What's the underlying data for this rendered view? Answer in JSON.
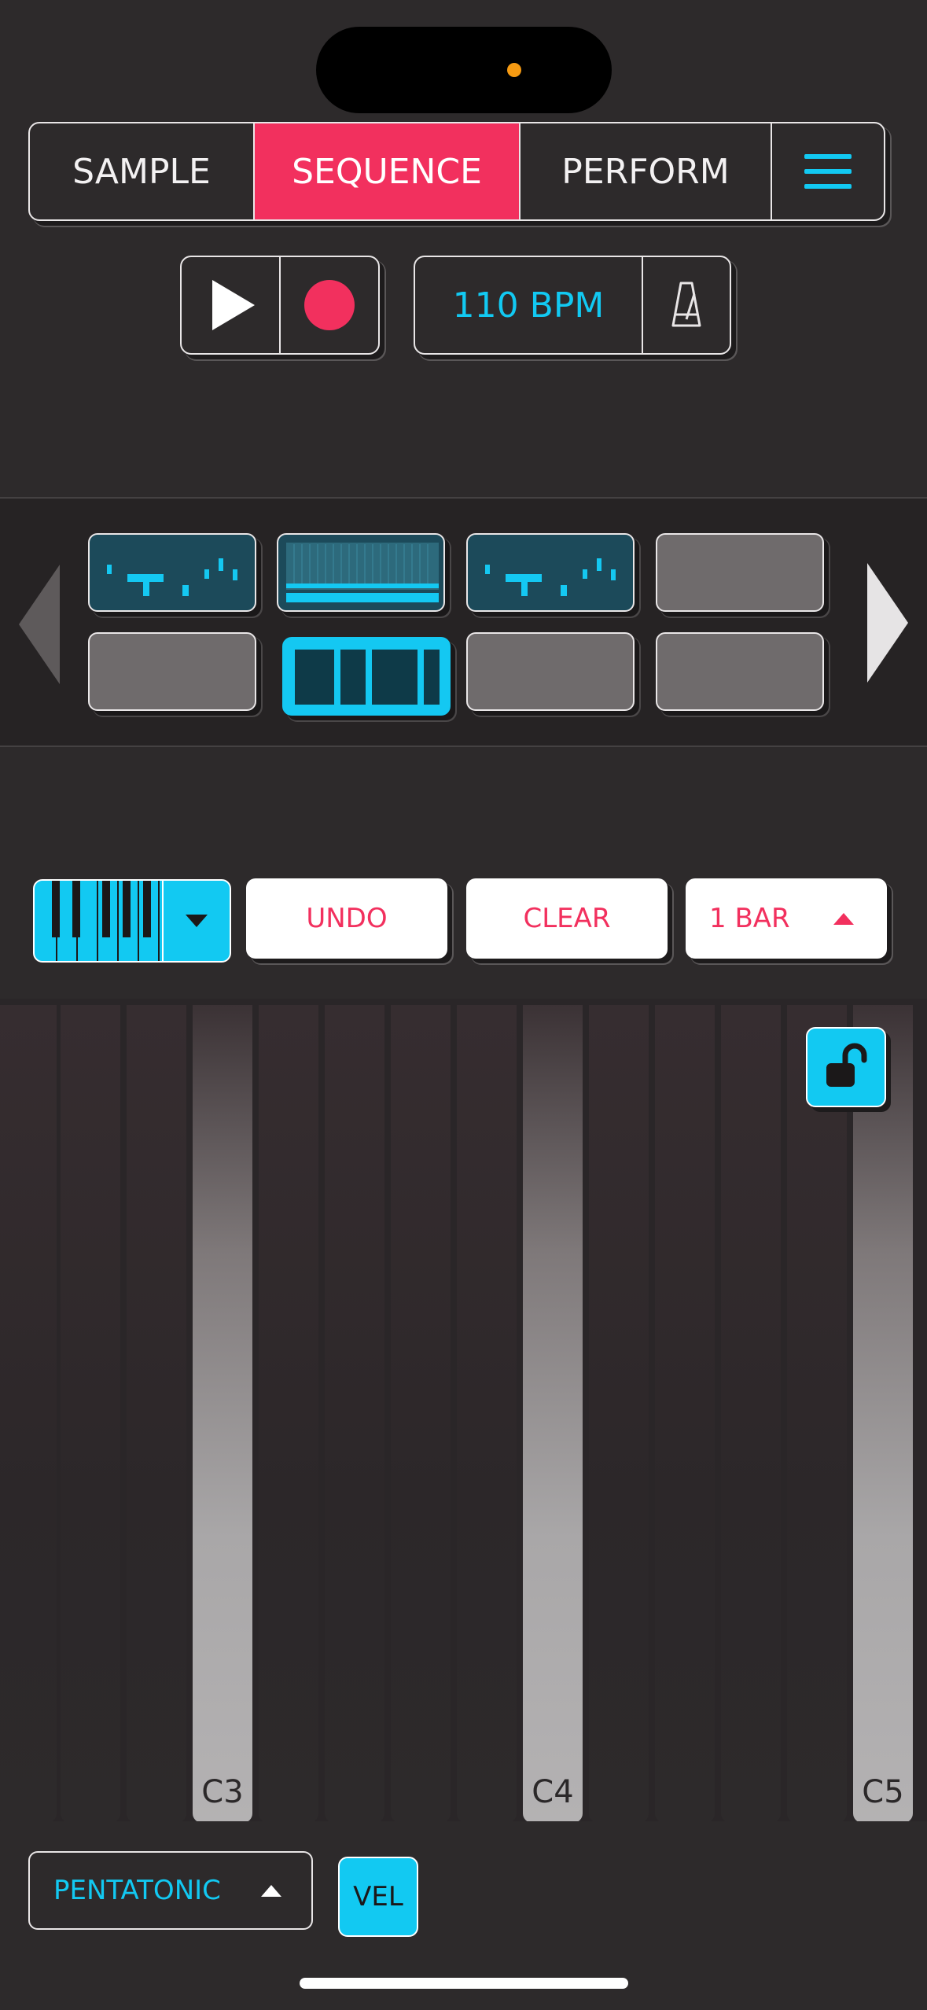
{
  "tabs": {
    "sample": "SAMPLE",
    "sequence": "SEQUENCE",
    "perform": "PERFORM"
  },
  "transport": {
    "bpm": "110 BPM"
  },
  "toolbar": {
    "undo": "UNDO",
    "clear": "CLEAR",
    "bar_length": "1 BAR"
  },
  "patterns": [
    {
      "slot": 1,
      "state": "filled"
    },
    {
      "slot": 2,
      "state": "filled"
    },
    {
      "slot": 3,
      "state": "filled"
    },
    {
      "slot": 4,
      "state": "empty"
    },
    {
      "slot": 5,
      "state": "empty"
    },
    {
      "slot": 6,
      "state": "selected"
    },
    {
      "slot": 7,
      "state": "empty"
    },
    {
      "slot": 8,
      "state": "empty"
    }
  ],
  "piano_roll": {
    "labels": [
      "C3",
      "C4",
      "C5"
    ]
  },
  "bottom": {
    "scale": "PENTATONIC",
    "velocity": "VEL"
  },
  "colors": {
    "accent_red": "#f2305e",
    "accent_cyan": "#12c9f2",
    "background": "#2d2a2b"
  },
  "icons": [
    "menu-icon",
    "play-icon",
    "record-icon",
    "metronome-icon",
    "keyboard-icon",
    "chevron-down-icon",
    "chevron-up-icon",
    "unlock-icon",
    "arrow-left-icon",
    "arrow-right-icon"
  ]
}
